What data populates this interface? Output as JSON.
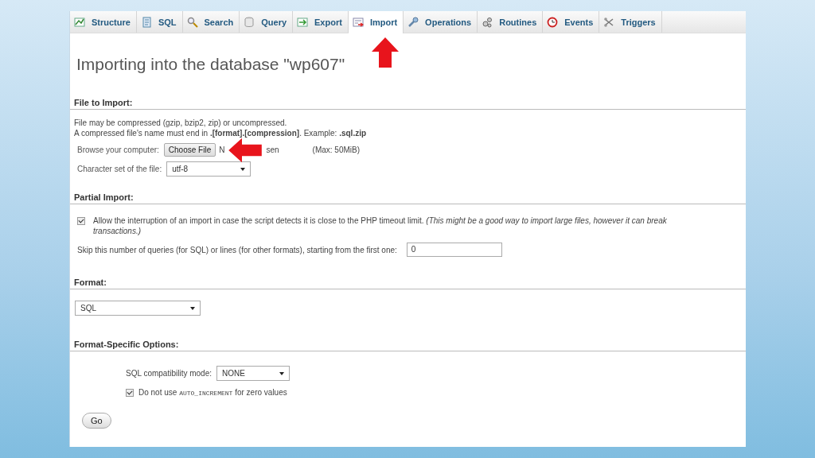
{
  "tabs": [
    {
      "label": "Structure",
      "selected": false
    },
    {
      "label": "SQL",
      "selected": false
    },
    {
      "label": "Search",
      "selected": false
    },
    {
      "label": "Query",
      "selected": false
    },
    {
      "label": "Export",
      "selected": false
    },
    {
      "label": "Import",
      "selected": true
    },
    {
      "label": "Operations",
      "selected": false
    },
    {
      "label": "Routines",
      "selected": false
    },
    {
      "label": "Events",
      "selected": false
    },
    {
      "label": "Triggers",
      "selected": false
    }
  ],
  "page_title": "Importing into the database \"wp607\"",
  "file_to_import": {
    "heading": "File to Import:",
    "note_1": "File may be compressed (gzip, bzip2, zip) or uncompressed.",
    "note_2": "A compressed file's name must end in **.[format].[compression]**. Example: **.sql.zip**",
    "browse_label": "Browse your computer:",
    "choose_button": "Choose File",
    "file_status_start": "N",
    "file_status_end": "sen",
    "max_size": "(Max: 50MiB)",
    "charset_label": "Character set of the file:",
    "charset_value": "utf-8"
  },
  "partial_import": {
    "heading": "Partial Import:",
    "allow_interrupt": {
      "checked": true,
      "label": "Allow the interruption of an import in case the script detects it is close to the PHP timeout limit. *(This might be a good way to import large files, however it can break transactions.)*"
    },
    "skip_label": "Skip this number of queries (for SQL) or lines (for other formats), starting from the first one:",
    "skip_value": "0"
  },
  "format": {
    "heading": "Format:",
    "value": "SQL"
  },
  "format_options": {
    "heading": "Format-Specific Options:",
    "compat_label": "SQL compatibility mode:",
    "compat_value": "NONE",
    "no_auto_increment": {
      "checked": true,
      "text_before": "Do not use",
      "code": "AUTO_INCREMENT",
      "text_after": "for zero values"
    }
  },
  "go_button": "Go"
}
